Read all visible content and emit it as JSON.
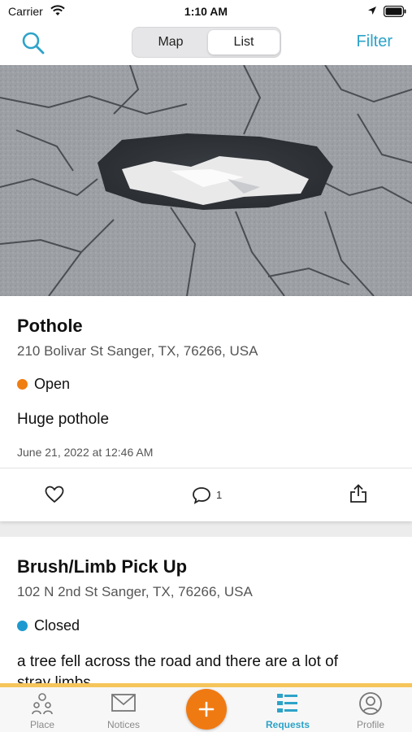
{
  "status_bar": {
    "carrier": "Carrier",
    "time": "1:10 AM"
  },
  "nav": {
    "segments": [
      "Map",
      "List"
    ],
    "selected_segment": "List",
    "filter_label": "Filter",
    "accent_color": "#2da3c8"
  },
  "requests": [
    {
      "title": "Pothole",
      "address": "210 Bolivar St Sanger, TX, 76266, USA",
      "status": "Open",
      "status_color": "#ef7d10",
      "description": "Huge pothole",
      "date": "June 21, 2022 at 12:46 AM",
      "comment_count": "1",
      "image": "pothole-photo"
    },
    {
      "title": "Brush/Limb Pick Up",
      "address": "102 N 2nd St Sanger, TX, 76266, USA",
      "status": "Closed",
      "status_color": "#1c9ad0",
      "description": "a tree fell across the road and there are a lot of",
      "description_cont": "stray limbs"
    }
  ],
  "tabs": [
    {
      "label": "Place",
      "icon": "place-people-icon"
    },
    {
      "label": "Notices",
      "icon": "envelope-icon"
    },
    {
      "label": "",
      "icon": "plus-icon"
    },
    {
      "label": "Requests",
      "icon": "list-icon",
      "active": true
    },
    {
      "label": "Profile",
      "icon": "profile-icon"
    }
  ],
  "fab_color": "#f07a12"
}
